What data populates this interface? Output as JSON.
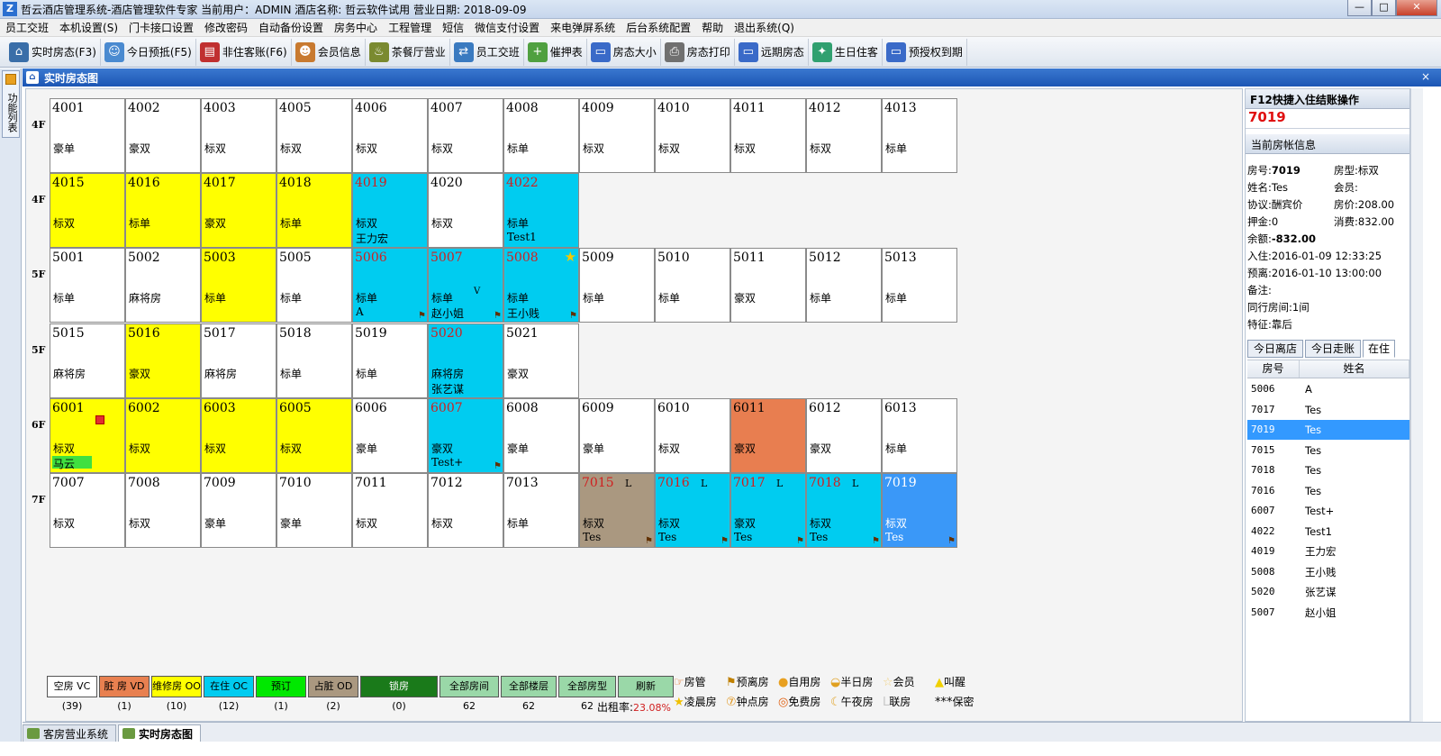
{
  "app": {
    "title": "哲云酒店管理系统-酒店管理软件专家   当前用户：ADMIN  酒店名称: 哲云软件试用  营业日期: 2018-09-09",
    "win_min": "—",
    "win_max": "□",
    "win_close": "✕"
  },
  "menu": [
    "员工交班",
    "本机设置(S)",
    "门卡接口设置",
    "修改密码",
    "自动备份设置",
    "房务中心",
    "工程管理",
    "短信",
    "微信支付设置",
    "来电弹屏系统",
    "后台系统配置",
    "帮助",
    "退出系统(Q)"
  ],
  "toolbar": [
    {
      "label": "实时房态(F3)",
      "icon": "house-icon",
      "color": "#3a6ea8"
    },
    {
      "label": "今日预抵(F5)",
      "icon": "person-icon",
      "color": "#4a8ad0"
    },
    {
      "label": "非住客账(F6)",
      "icon": "ledger-icon",
      "color": "#c03030"
    },
    {
      "label": "会员信息",
      "icon": "members-icon",
      "color": "#c87a30"
    },
    {
      "label": "茶餐厅营业",
      "icon": "dining-icon",
      "color": "#7a8a30"
    },
    {
      "label": "员工交班",
      "icon": "handover-icon",
      "color": "#3a7ac0"
    },
    {
      "label": "催押表",
      "icon": "add-doc-icon",
      "color": "#50a040"
    },
    {
      "label": "房态大小",
      "icon": "monitor-icon",
      "color": "#3a6ac8"
    },
    {
      "label": "房态打印",
      "icon": "printer-icon",
      "color": "#707070"
    },
    {
      "label": "远期房态",
      "icon": "monitor-icon",
      "color": "#3a6ac8"
    },
    {
      "label": "生日住客",
      "icon": "birthday-icon",
      "color": "#30a070"
    },
    {
      "label": "预授权到期",
      "icon": "monitor-icon",
      "color": "#3a6ac8"
    }
  ],
  "side_tab": "功能列表",
  "panel_title": "实时房态图",
  "panel_close": "×",
  "floors": [
    "4F",
    "4F",
    "5F",
    "5F",
    "6F",
    "7F"
  ],
  "rows": [
    [
      {
        "no": "4001",
        "type": "豪单"
      },
      {
        "no": "4002",
        "type": "豪双"
      },
      {
        "no": "4003",
        "type": "标双"
      },
      {
        "no": "4005",
        "type": "标双"
      },
      {
        "no": "4006",
        "type": "标双"
      },
      {
        "no": "4007",
        "type": "标双"
      },
      {
        "no": "4008",
        "type": "标单"
      },
      {
        "no": "4009",
        "type": "标双"
      },
      {
        "no": "4010",
        "type": "标双"
      },
      {
        "no": "4011",
        "type": "标双"
      },
      {
        "no": "4012",
        "type": "标双"
      },
      {
        "no": "4013",
        "type": "标单"
      }
    ],
    [
      {
        "no": "4015",
        "type": "标双",
        "st": "yel"
      },
      {
        "no": "4016",
        "type": "标单",
        "st": "yel"
      },
      {
        "no": "4017",
        "type": "豪双",
        "st": "yel"
      },
      {
        "no": "4018",
        "type": "标单",
        "st": "yel"
      },
      {
        "no": "4019",
        "type": "标双",
        "guest": "王力宏",
        "st": "cy",
        "red": true
      },
      {
        "no": "4020",
        "type": "标双"
      },
      {
        "no": "4022",
        "type": "标单",
        "guest": "Test1",
        "st": "cy",
        "red": true
      }
    ],
    [
      {
        "no": "5001",
        "type": "标单"
      },
      {
        "no": "5002",
        "type": "麻将房"
      },
      {
        "no": "5003",
        "type": "标单",
        "st": "yel"
      },
      {
        "no": "5005",
        "type": "标单"
      },
      {
        "no": "5006",
        "type": "标单",
        "guest": "A",
        "st": "cy",
        "red": true,
        "pin": true
      },
      {
        "no": "5007",
        "type": "标单",
        "guest": "赵小姐",
        "st": "cy",
        "red": true,
        "pin": true,
        "flag2": "V"
      },
      {
        "no": "5008",
        "type": "标单",
        "guest": "王小贱",
        "st": "cy",
        "red": true,
        "pin": true,
        "star": true
      },
      {
        "no": "5009",
        "type": "标单"
      },
      {
        "no": "5010",
        "type": "标单"
      },
      {
        "no": "5011",
        "type": "豪双"
      },
      {
        "no": "5012",
        "type": "标单"
      },
      {
        "no": "5013",
        "type": "标单"
      }
    ],
    [
      {
        "no": "5015",
        "type": "麻将房"
      },
      {
        "no": "5016",
        "type": "豪双",
        "st": "yel"
      },
      {
        "no": "5017",
        "type": "麻将房"
      },
      {
        "no": "5018",
        "type": "标单"
      },
      {
        "no": "5019",
        "type": "标单"
      },
      {
        "no": "5020",
        "type": "麻将房",
        "guest": "张艺谋",
        "st": "cy",
        "red": true
      },
      {
        "no": "5021",
        "type": "豪双"
      }
    ],
    [
      {
        "no": "6001",
        "type": "标双",
        "guest": "马云",
        "st": "yel",
        "badge": true,
        "hl": true
      },
      {
        "no": "6002",
        "type": "标双",
        "st": "yel"
      },
      {
        "no": "6003",
        "type": "标双",
        "st": "yel"
      },
      {
        "no": "6005",
        "type": "标双",
        "st": "yel"
      },
      {
        "no": "6006",
        "type": "豪单"
      },
      {
        "no": "6007",
        "type": "豪双",
        "guest": "Test+",
        "st": "cy",
        "red": true,
        "pin": true
      },
      {
        "no": "6008",
        "type": "豪单"
      },
      {
        "no": "6009",
        "type": "豪单"
      },
      {
        "no": "6010",
        "type": "标双"
      },
      {
        "no": "6011",
        "type": "豪双",
        "st": "or"
      },
      {
        "no": "6012",
        "type": "豪双"
      },
      {
        "no": "6013",
        "type": "标单"
      }
    ],
    [
      {
        "no": "7007",
        "type": "标双"
      },
      {
        "no": "7008",
        "type": "标双"
      },
      {
        "no": "7009",
        "type": "豪单"
      },
      {
        "no": "7010",
        "type": "豪单"
      },
      {
        "no": "7011",
        "type": "标双"
      },
      {
        "no": "7012",
        "type": "标双"
      },
      {
        "no": "7013",
        "type": "标单"
      },
      {
        "no": "7015",
        "type": "标双",
        "guest": "Tes",
        "st": "gr",
        "red": true,
        "pin": true,
        "flag": "L"
      },
      {
        "no": "7016",
        "type": "标双",
        "guest": "Tes",
        "st": "cy",
        "red": true,
        "pin": true,
        "flag": "L"
      },
      {
        "no": "7017",
        "type": "豪双",
        "guest": "Tes",
        "st": "cy",
        "red": true,
        "pin": true,
        "flag": "L"
      },
      {
        "no": "7018",
        "type": "标双",
        "guest": "Tes",
        "st": "cy",
        "red": true,
        "pin": true,
        "flag": "L"
      },
      {
        "no": "7019",
        "type": "标双",
        "guest": "Tes",
        "st": "bl",
        "pin": true
      }
    ]
  ],
  "legend": [
    {
      "label": "空房 VC",
      "count": "(39)",
      "bg": "#ffffff",
      "w": 56
    },
    {
      "label": "脏  房 VD",
      "count": "(1)",
      "bg": "#e88050",
      "w": 56
    },
    {
      "label": "维修房 OO",
      "count": "(10)",
      "bg": "#ffff00",
      "w": 56
    },
    {
      "label": "在住 OC",
      "count": "(12)",
      "bg": "#00ccf0",
      "w": 56
    },
    {
      "label": "预订",
      "count": "(1)",
      "bg": "#00e800",
      "w": 56
    },
    {
      "label": "占脏 OD",
      "count": "(2)",
      "bg": "#aa9880",
      "w": 56
    },
    {
      "label": "锁房",
      "count": "(0)",
      "bg": "#1a7a1a",
      "w": 86
    },
    {
      "label": "全部房间",
      "count": "62",
      "bg": "#9ad8a8",
      "w": 66
    },
    {
      "label": "全部楼层",
      "count": "62",
      "bg": "#9ad8a8",
      "w": 62
    },
    {
      "label": "全部房型",
      "count": "62",
      "bg": "#9ad8a8",
      "w": 64
    },
    {
      "label": "刷新",
      "count": "",
      "bg": "#9ad8a8",
      "w": 62
    }
  ],
  "occupancy_label": "出租率:",
  "occupancy_value": "23.08%",
  "status_key": [
    {
      "g": "☞",
      "label": "房管",
      "c": "#e07020"
    },
    {
      "g": "⚑",
      "label": "预离房",
      "c": "#c08000"
    },
    {
      "g": "●",
      "label": "自用房",
      "c": "#e8a020"
    },
    {
      "g": "◒",
      "label": "半日房",
      "c": "#e0a020"
    },
    {
      "g": "☆",
      "label": "会员",
      "c": "#f0d080"
    },
    {
      "g": "▲",
      "label": "叫醒",
      "c": "#f0d000"
    },
    {
      "g": "★",
      "label": "凌晨房",
      "c": "#f0c000"
    },
    {
      "g": "⑦",
      "label": "钟点房",
      "c": "#e09010"
    },
    {
      "g": "◎",
      "label": "免费房",
      "c": "#e06010"
    },
    {
      "g": "☾",
      "label": "午夜房",
      "c": "#e0a020"
    },
    {
      "g": "L",
      "label": "联房",
      "c": "#c8c8c8"
    },
    {
      "g": "***",
      "label": "保密",
      "c": "#000000"
    }
  ],
  "right": {
    "quick_title": "F12快捷入住结账操作",
    "quick_room": "7019",
    "info_title": "当前房帐信息",
    "info": {
      "room_no_label": "房号:",
      "room_no": "7019",
      "room_type_label": "房型:",
      "room_type": "标双",
      "name_label": "姓名:",
      "name": "Tes",
      "member_label": "会员:",
      "member": "",
      "agreement_label": "协议:",
      "agreement": "酬宾价",
      "price_label": "房价:",
      "price": "208.00",
      "deposit_label": "押金:",
      "deposit": "0",
      "consume_label": "消费:",
      "consume": "832.00",
      "balance_label": "余额:",
      "balance": "-832.00",
      "checkin_label": "入住:",
      "checkin": "2016-01-09 12:33:25",
      "checkout_label": "预离:",
      "checkout": "2016-01-10 13:00:00",
      "remark_label": "备注:",
      "remark": "",
      "together_label": "同行房间:",
      "together": "1间",
      "feature_label": "特征:",
      "feature": "靠后"
    },
    "tabs": [
      "今日离店",
      "今日走账",
      "在住"
    ],
    "table_head": [
      "房号",
      "姓名"
    ],
    "table": [
      [
        "5006",
        "A"
      ],
      [
        "7017",
        "Tes"
      ],
      [
        "7019",
        "Tes"
      ],
      [
        "7015",
        "Tes"
      ],
      [
        "7018",
        "Tes"
      ],
      [
        "7016",
        "Tes"
      ],
      [
        "6007",
        "Test+"
      ],
      [
        "4022",
        "Test1"
      ],
      [
        "4019",
        "王力宏"
      ],
      [
        "5008",
        "王小贱"
      ],
      [
        "5020",
        "张艺谋"
      ],
      [
        "5007",
        "赵小姐"
      ]
    ]
  },
  "status_tabs": [
    "客房营业系统",
    "实时房态图"
  ]
}
